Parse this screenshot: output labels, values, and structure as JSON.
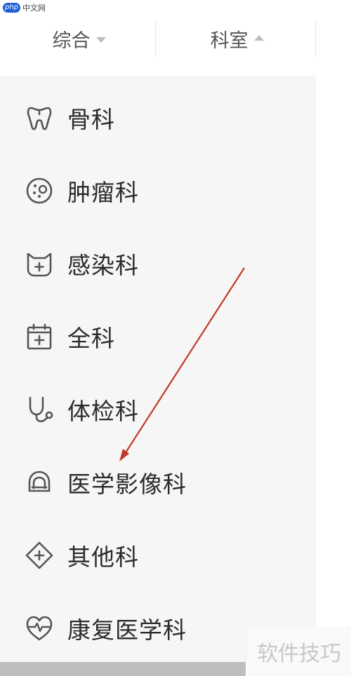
{
  "watermark_top": {
    "logo": "php",
    "text": "中文网"
  },
  "tabs": [
    {
      "label": "综合",
      "caret": "caret-down-icon"
    },
    {
      "label": "科室",
      "caret": "caret-up-icon"
    }
  ],
  "departments": [
    {
      "label": "骨科",
      "icon": "tooth-icon"
    },
    {
      "label": "肿瘤科",
      "icon": "cell-icon"
    },
    {
      "label": "感染科",
      "icon": "virus-icon"
    },
    {
      "label": "全科",
      "icon": "calendar-plus-icon"
    },
    {
      "label": "体检科",
      "icon": "stethoscope-icon"
    },
    {
      "label": "医学影像科",
      "icon": "mri-scanner-icon"
    },
    {
      "label": "其他科",
      "icon": "diamond-plus-icon"
    },
    {
      "label": "康复医学科",
      "icon": "heart-pulse-icon"
    }
  ],
  "watermark_bottom": "软件技巧",
  "colors": {
    "icon_stroke": "#555555",
    "arrow": "#c0392b",
    "list_bg": "#f6f6f6"
  }
}
